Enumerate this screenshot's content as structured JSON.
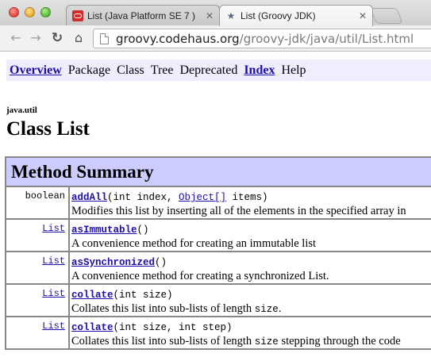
{
  "browser": {
    "tabs": [
      {
        "title": "List (Java Platform SE 7 )",
        "favicon": "oracle-icon",
        "active": false
      },
      {
        "title": "List (Groovy JDK)",
        "favicon": "groovy-icon",
        "active": true
      }
    ],
    "url_domain": "groovy.codehaus.org",
    "url_path": "/groovy-jdk/java/util/List.html"
  },
  "nav": {
    "overview": "Overview",
    "package": "Package",
    "class": "Class",
    "tree": "Tree",
    "deprecated": "Deprecated",
    "index": "Index",
    "help": "Help"
  },
  "page": {
    "package_name": "java.util",
    "class_title": "Class List"
  },
  "summary": {
    "heading": "Method Summary",
    "rows": [
      {
        "return_type": "boolean",
        "return_link": false,
        "method": "addAll",
        "params_pre": "(int index, ",
        "param_link": "Object[]",
        "params_post": " items)",
        "desc_pre": "Modifies this list by inserting all of the elements in the specified array in",
        "desc_code": "",
        "desc_post": ""
      },
      {
        "return_type": "List",
        "return_link": true,
        "method": "asImmutable",
        "params_pre": "()",
        "param_link": "",
        "params_post": "",
        "desc_pre": "A convenience method for creating an immutable list",
        "desc_code": "",
        "desc_post": ""
      },
      {
        "return_type": "List",
        "return_link": true,
        "method": "asSynchronized",
        "params_pre": "()",
        "param_link": "",
        "params_post": "",
        "desc_pre": "A convenience method for creating a synchronized List.",
        "desc_code": "",
        "desc_post": ""
      },
      {
        "return_type": "List",
        "return_link": true,
        "method": "collate",
        "params_pre": "(int size)",
        "param_link": "",
        "params_post": "",
        "desc_pre": "Collates this list into sub-lists of length ",
        "desc_code": "size",
        "desc_post": "."
      },
      {
        "return_type": "List",
        "return_link": true,
        "method": "collate",
        "params_pre": "(int size, int step)",
        "param_link": "",
        "params_post": "",
        "desc_pre": "Collates this list into sub-lists of length ",
        "desc_code": "size",
        "desc_post": " stepping through the code"
      }
    ]
  },
  "colors": {
    "navbar_bg": "#eeeeff",
    "table_header_bg": "#ccccff",
    "link": "#1a0dab"
  }
}
